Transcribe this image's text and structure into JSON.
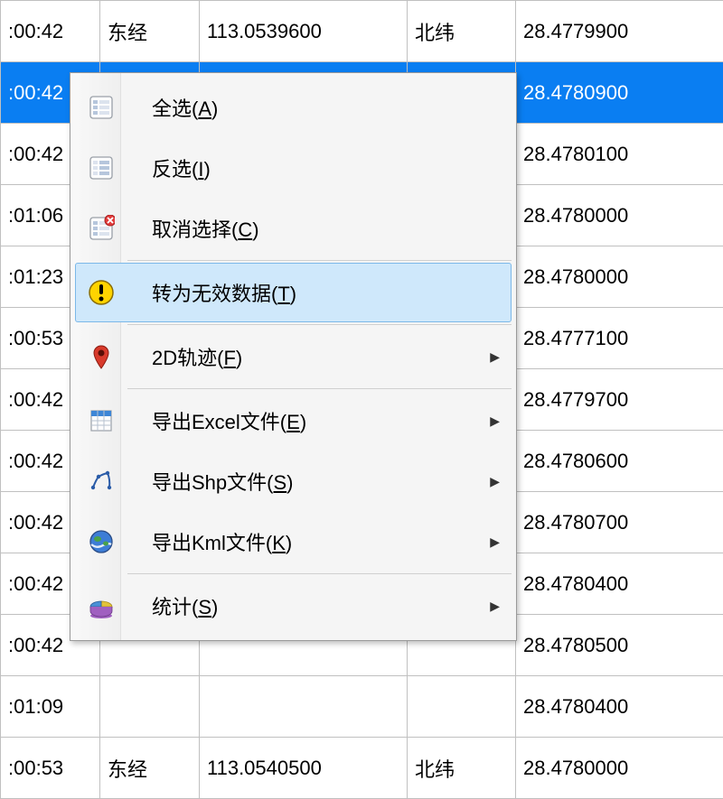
{
  "table": {
    "rows": [
      {
        "time": ":00:42",
        "lon_label": "东经",
        "lon": "113.0539600",
        "lat_label": "北纬",
        "lat": "28.4779900",
        "selected": false
      },
      {
        "time": ":00:42",
        "lon_label": "",
        "lon": "",
        "lat_label": "",
        "lat": "28.4780900",
        "selected": true
      },
      {
        "time": ":00:42",
        "lon_label": "",
        "lon": "",
        "lat_label": "",
        "lat": "28.4780100",
        "selected": false
      },
      {
        "time": ":01:06",
        "lon_label": "",
        "lon": "",
        "lat_label": "",
        "lat": "28.4780000",
        "selected": false
      },
      {
        "time": ":01:23",
        "lon_label": "",
        "lon": "",
        "lat_label": "",
        "lat": "28.4780000",
        "selected": false
      },
      {
        "time": ":00:53",
        "lon_label": "",
        "lon": "",
        "lat_label": "",
        "lat": "28.4777100",
        "selected": false
      },
      {
        "time": ":00:42",
        "lon_label": "",
        "lon": "",
        "lat_label": "",
        "lat": "28.4779700",
        "selected": false
      },
      {
        "time": ":00:42",
        "lon_label": "",
        "lon": "",
        "lat_label": "",
        "lat": "28.4780600",
        "selected": false
      },
      {
        "time": ":00:42",
        "lon_label": "",
        "lon": "",
        "lat_label": "",
        "lat": "28.4780700",
        "selected": false
      },
      {
        "time": ":00:42",
        "lon_label": "",
        "lon": "",
        "lat_label": "",
        "lat": "28.4780400",
        "selected": false
      },
      {
        "time": ":00:42",
        "lon_label": "",
        "lon": "",
        "lat_label": "",
        "lat": "28.4780500",
        "selected": false
      },
      {
        "time": ":01:09",
        "lon_label": "",
        "lon": "",
        "lat_label": "",
        "lat": "28.4780400",
        "selected": false
      },
      {
        "time": ":00:53",
        "lon_label": "东经",
        "lon": "113.0540500",
        "lat_label": "北纬",
        "lat": "28.4780000",
        "selected": false
      }
    ]
  },
  "menu": {
    "items": [
      {
        "icon": "list-icon",
        "label": "全选",
        "accel": "A",
        "submenu": false
      },
      {
        "icon": "list-inverse-icon",
        "label": "反选",
        "accel": "I",
        "submenu": false
      },
      {
        "icon": "list-cancel-icon",
        "label": "取消选择",
        "accel": "C",
        "submenu": false
      },
      {
        "sep": true
      },
      {
        "icon": "warning-icon",
        "label": "转为无效数据",
        "accel": "T",
        "submenu": false,
        "hovered": true
      },
      {
        "sep": true
      },
      {
        "icon": "pin-icon",
        "label": "2D轨迹",
        "accel": "F",
        "submenu": true
      },
      {
        "sep": true
      },
      {
        "icon": "excel-icon",
        "label": "导出Excel文件",
        "accel": "E",
        "submenu": true
      },
      {
        "icon": "shp-icon",
        "label": "导出Shp文件",
        "accel": "S",
        "submenu": true
      },
      {
        "icon": "kml-icon",
        "label": "导出Kml文件",
        "accel": "K",
        "submenu": true
      },
      {
        "sep": true
      },
      {
        "icon": "chart-icon",
        "label": "统计",
        "accel": "S",
        "submenu": true
      }
    ]
  }
}
